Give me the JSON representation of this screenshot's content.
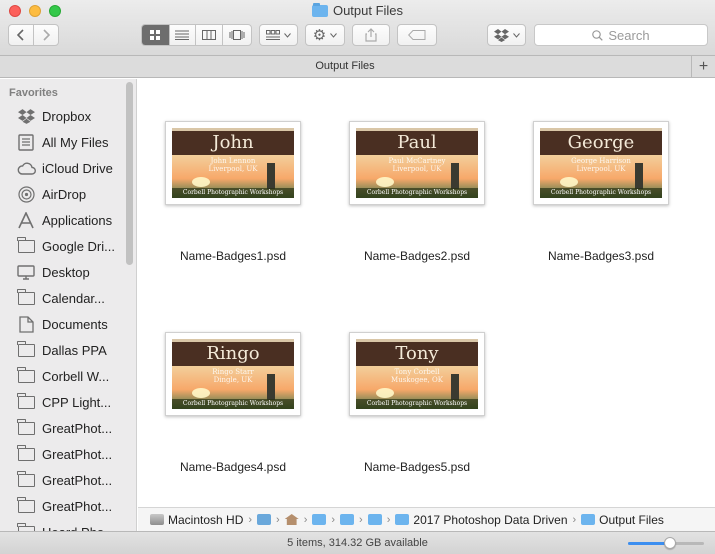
{
  "window": {
    "title": "Output Files"
  },
  "toolbar": {
    "search_placeholder": "Search",
    "icons": [
      "chevron-left-icon",
      "chevron-right-icon",
      "icon-view-icon",
      "list-view-icon",
      "column-view-icon",
      "cover-flow-icon",
      "arrange-icon",
      "gear-icon",
      "share-icon",
      "tag-icon",
      "dropbox-icon",
      "search-icon"
    ]
  },
  "tabbar": {
    "label": "Output Files",
    "add_label": "+"
  },
  "sidebar": {
    "heading": "Favorites",
    "items": [
      {
        "label": "Dropbox",
        "icon": "dropbox-icon"
      },
      {
        "label": "All My Files",
        "icon": "all-files-icon"
      },
      {
        "label": "iCloud Drive",
        "icon": "cloud-icon"
      },
      {
        "label": "AirDrop",
        "icon": "airdrop-icon"
      },
      {
        "label": "Applications",
        "icon": "applications-icon"
      },
      {
        "label": "Google Dri...",
        "icon": "folder-icon"
      },
      {
        "label": "Desktop",
        "icon": "desktop-icon"
      },
      {
        "label": "Calendar...",
        "icon": "folder-icon"
      },
      {
        "label": "Documents",
        "icon": "documents-icon"
      },
      {
        "label": "Dallas PPA",
        "icon": "folder-icon"
      },
      {
        "label": "Corbell W...",
        "icon": "folder-icon"
      },
      {
        "label": "CPP Light...",
        "icon": "folder-icon"
      },
      {
        "label": "GreatPhot...",
        "icon": "folder-icon"
      },
      {
        "label": "GreatPhot...",
        "icon": "folder-icon"
      },
      {
        "label": "GreatPhot...",
        "icon": "folder-icon"
      },
      {
        "label": "GreatPhot...",
        "icon": "folder-icon"
      },
      {
        "label": "Heard Pho...",
        "icon": "folder-icon"
      }
    ]
  },
  "files": [
    {
      "name": "Name-Badges1.psd",
      "badge_name": "John",
      "badge_sub1": "John Lennon",
      "badge_sub2": "Liverpool, UK",
      "badge_footer": "Corbell Photographic Workshops"
    },
    {
      "name": "Name-Badges2.psd",
      "badge_name": "Paul",
      "badge_sub1": "Paul McCartney",
      "badge_sub2": "Liverpool, UK",
      "badge_footer": "Corbell Photographic Workshops"
    },
    {
      "name": "Name-Badges3.psd",
      "badge_name": "George",
      "badge_sub1": "George Harrison",
      "badge_sub2": "Liverpool, UK",
      "badge_footer": "Corbell Photographic Workshops"
    },
    {
      "name": "Name-Badges4.psd",
      "badge_name": "Ringo",
      "badge_sub1": "Ringo Starr",
      "badge_sub2": "Dingle, UK",
      "badge_footer": "Corbell Photographic Workshops"
    },
    {
      "name": "Name-Badges5.psd",
      "badge_name": "Tony",
      "badge_sub1": "Tony Corbell",
      "badge_sub2": "Muskogee, OK",
      "badge_footer": "Corbell Photographic Workshops"
    }
  ],
  "pathbar": {
    "items": [
      {
        "label": "Macintosh HD",
        "icon": "hard-drive-icon"
      },
      {
        "label": "",
        "icon": "user-folder-icon"
      },
      {
        "label": "",
        "icon": "home-icon"
      },
      {
        "label": "",
        "icon": "folder-icon"
      },
      {
        "label": "",
        "icon": "folder-icon"
      },
      {
        "label": "",
        "icon": "folder-icon"
      },
      {
        "label": "2017 Photoshop Data Driven",
        "icon": "folder-icon"
      },
      {
        "label": "Output Files",
        "icon": "folder-icon"
      }
    ]
  },
  "statusbar": {
    "text": "5 items, 314.32 GB available",
    "icon_size_level": 0.55
  }
}
